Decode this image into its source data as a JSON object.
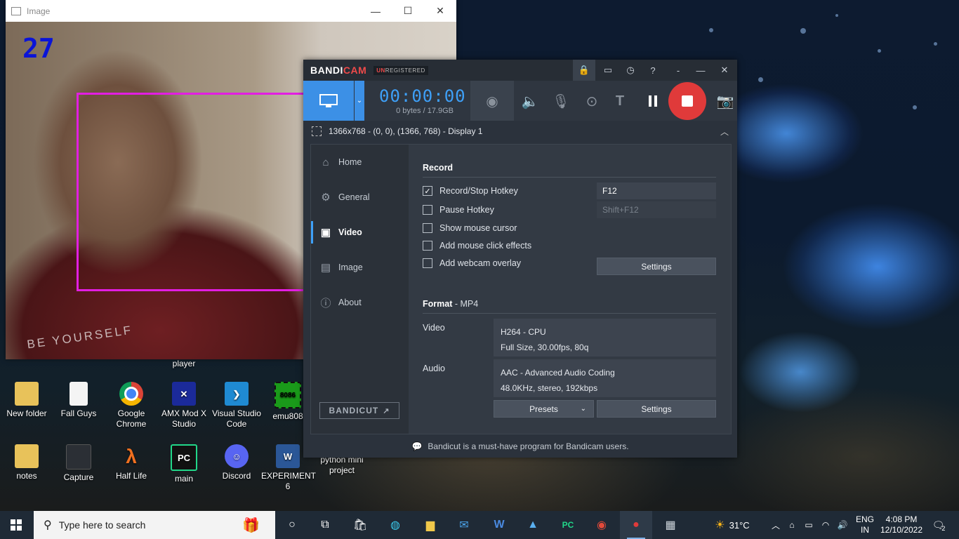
{
  "image_window": {
    "title": "Image",
    "frame_count": "27",
    "shirt_text": "BE YOURSELF"
  },
  "bandicam": {
    "logo_main": "BANDI",
    "logo_accent": "CAM",
    "unregistered_prefix": "UN",
    "unregistered_rest": "REGISTERED",
    "timer": "00:00:00",
    "file_size": "0 bytes / 17.9GB",
    "capture_area": "1366x768 - (0, 0), (1366, 768) - Display 1",
    "nav": [
      {
        "label": "Home",
        "icon": "home-icon"
      },
      {
        "label": "General",
        "icon": "gear-icon"
      },
      {
        "label": "Video",
        "icon": "video-settings-icon",
        "active": true
      },
      {
        "label": "Image",
        "icon": "image-settings-icon"
      },
      {
        "label": "About",
        "icon": "info-icon"
      }
    ],
    "bandicut_label": "BANDICUT",
    "record": {
      "heading": "Record",
      "options": [
        {
          "label": "Record/Stop Hotkey",
          "checked": true
        },
        {
          "label": "Pause Hotkey",
          "checked": false
        },
        {
          "label": "Show mouse cursor",
          "checked": false
        },
        {
          "label": "Add mouse click effects",
          "checked": false
        },
        {
          "label": "Add webcam overlay",
          "checked": false
        }
      ],
      "hotkey_value": "F12",
      "pause_hotkey_value": "Shift+F12",
      "settings_label": "Settings"
    },
    "format": {
      "heading": "Format",
      "container": " - MP4",
      "video_label": "Video",
      "video_codec": "H264 - CPU",
      "video_detail": "Full Size, 30.00fps, 80q",
      "audio_label": "Audio",
      "audio_codec": "AAC - Advanced Audio Coding",
      "audio_detail": "48.0KHz, stereo, 192kbps",
      "presets_label": "Presets",
      "settings_label": "Settings"
    },
    "footer_text": "Bandicut is a must-have program for Bandicam users."
  },
  "desktop_icons": [
    {
      "label": "New folder"
    },
    {
      "label": "Fall Guys"
    },
    {
      "label": "Google Chrome"
    },
    {
      "label": "AMX Mod X Studio"
    },
    {
      "label": "Visual Studio Code"
    },
    {
      "label": "emu808"
    },
    {
      "label": "notes"
    },
    {
      "label": "Capture"
    },
    {
      "label": "Half Life"
    },
    {
      "label": "main"
    },
    {
      "label": "Discord"
    },
    {
      "label": "EXPERIMENT 6"
    },
    {
      "label": "python mini project"
    },
    {
      "label": "player"
    }
  ],
  "taskbar": {
    "search_placeholder": "Type here to search",
    "weather": "31°C",
    "language_top": "ENG",
    "language_bottom": "IN",
    "time": "4:08 PM",
    "date": "12/10/2022",
    "notification_count": "2"
  },
  "colors": {
    "bandicam_accent": "#3c90e6",
    "record_red": "#e03a3a",
    "face_box": "#e21ee2",
    "frame_count": "#0a14d8"
  }
}
